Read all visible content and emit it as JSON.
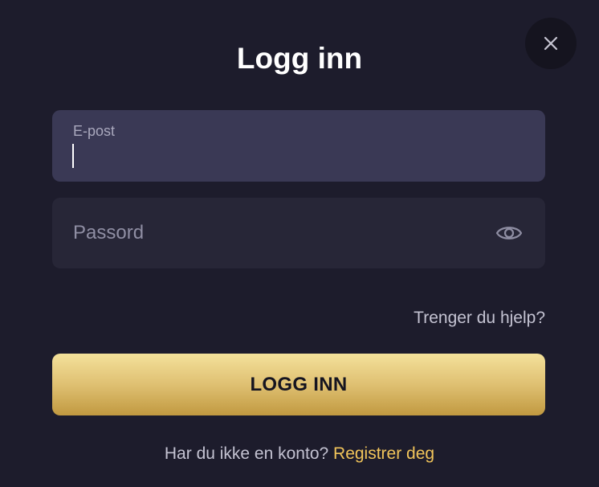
{
  "modal": {
    "title": "Logg inn",
    "close_icon": "close-icon"
  },
  "email_field": {
    "label": "E-post",
    "value": ""
  },
  "password_field": {
    "placeholder": "Passord",
    "value": "",
    "toggle_icon": "eye-icon"
  },
  "help_link": "Trenger du hjelp?",
  "submit_button": "LOGG INN",
  "footer": {
    "prompt": "Har du ikke en konto?",
    "register_link": "Registrer deg"
  },
  "colors": {
    "background": "#1d1c2c",
    "email_field_bg": "#3a3955",
    "password_field_bg": "#272637",
    "button_gradient_top": "#f4e19b",
    "button_gradient_bottom": "#c19940",
    "link_accent": "#f1c45a"
  }
}
